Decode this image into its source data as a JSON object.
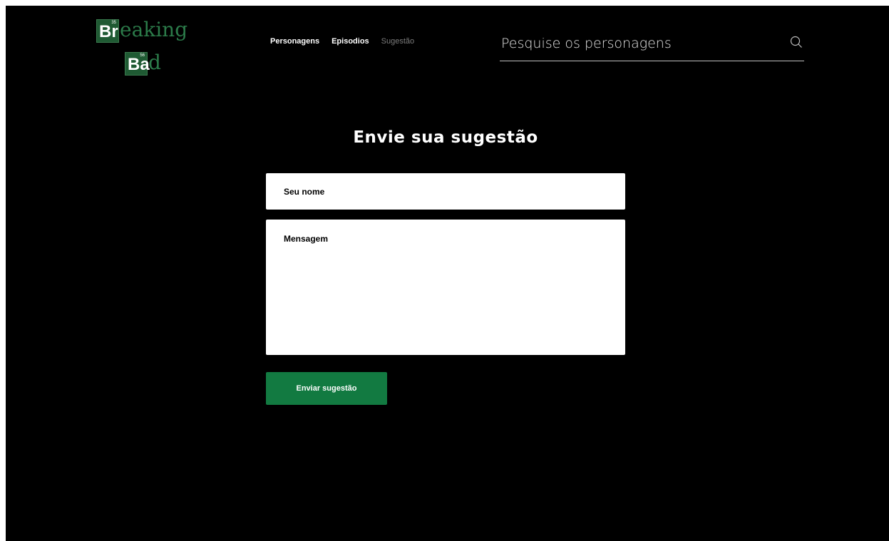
{
  "logo": {
    "line1_symbol": "Br",
    "line1_number": "35",
    "line1_rest": "eaking",
    "line2_symbol": "Ba",
    "line2_number": "56",
    "line2_rest": "d"
  },
  "nav": {
    "items": [
      {
        "label": "Personagens"
      },
      {
        "label": "Episodios"
      },
      {
        "label": "Sugestão"
      }
    ]
  },
  "search": {
    "placeholder": "Pesquise os personagens",
    "icon": "search-icon"
  },
  "page": {
    "title": "Envie sua sugestão"
  },
  "form": {
    "name_placeholder": "Seu nome",
    "message_placeholder": "Mensagem",
    "submit_label": "Enviar sugestão"
  },
  "colors": {
    "background": "#000000",
    "brand_green": "#127a41",
    "logo_green": "#1f5a33"
  }
}
